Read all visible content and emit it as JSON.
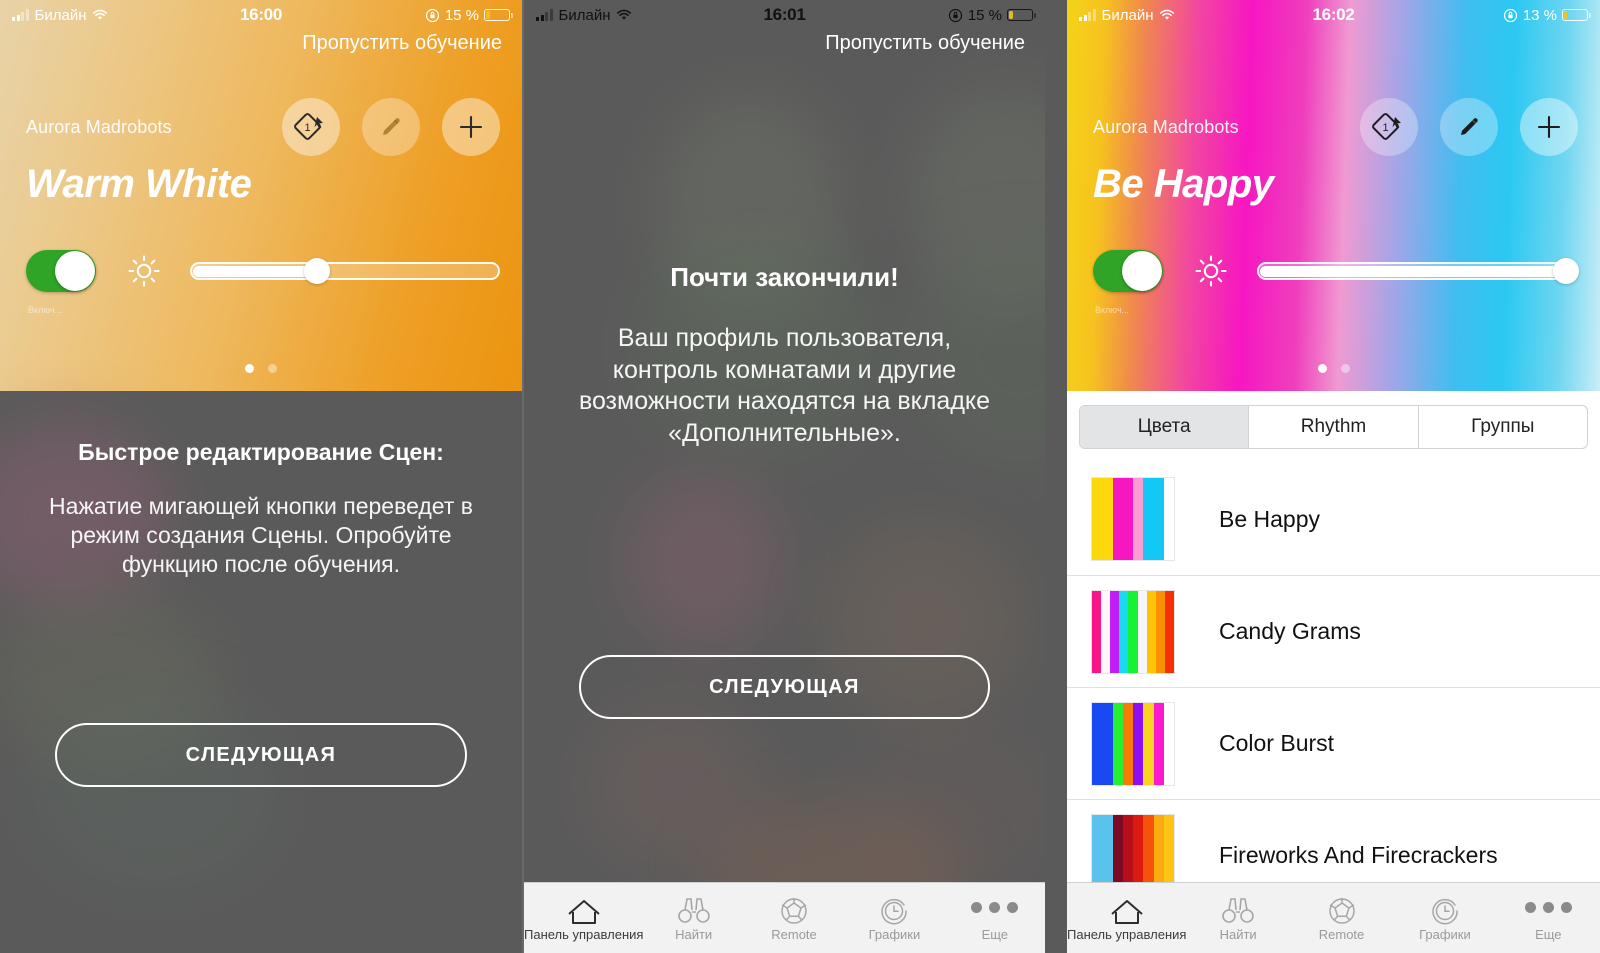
{
  "app": {
    "brand": "Aurora Madrobots",
    "skip_label": "Пропустить обучение"
  },
  "panels": [
    {
      "id": "panel-1",
      "status": {
        "carrier": "Билайн",
        "time": "16:00",
        "battery_pct": "15 %",
        "battery_level": 15,
        "style": "light"
      },
      "header": {
        "scene_name": "Warm White",
        "toggle_state": "on",
        "toggle_label": "Включ...",
        "brightness": 41,
        "page_dots": 2,
        "page_active": 0,
        "icons": [
          "scene-tag-icon",
          "pencil-icon",
          "plus-icon"
        ],
        "badge": "1",
        "gradient": [
          "#e8d3a8",
          "#eeb95f",
          "#eb9410"
        ]
      },
      "tutorial": {
        "title": "Быстрое редактирование Сцен:",
        "body": "Нажатие мигающей кнопки переведет в режим создания Сцены. Опробуйте функцию после обучения.",
        "next_label": "СЛЕДУЮЩАЯ"
      }
    },
    {
      "id": "panel-2",
      "status": {
        "carrier": "Билайн",
        "time": "16:01",
        "battery_pct": "15 %",
        "battery_level": 15,
        "style": "dark"
      },
      "tutorial": {
        "title": "Почти закончили!",
        "body": "Ваш профиль пользователя, контроль комнатами и другие возможности находятся на вкладке «Дополнительные».",
        "next_label": "СЛЕДУЮЩАЯ"
      },
      "tabbar": [
        {
          "label": "Панель управления",
          "icon": "home-icon",
          "active": true
        },
        {
          "label": "Найти",
          "icon": "binoculars-icon",
          "active": false
        },
        {
          "label": "Remote",
          "icon": "ball-icon",
          "active": false
        },
        {
          "label": "Графики",
          "icon": "clock-icon",
          "active": false
        },
        {
          "label": "Еще",
          "icon": "ellipsis-icon",
          "active": false
        }
      ]
    },
    {
      "id": "panel-3",
      "status": {
        "carrier": "Билайн",
        "time": "16:02",
        "battery_pct": "13 %",
        "battery_level": 13,
        "style": "light"
      },
      "header": {
        "scene_name": "Be Happy",
        "toggle_state": "on",
        "toggle_label": "Включ...",
        "brightness": 100,
        "page_dots": 2,
        "page_active": 0,
        "icons": [
          "scene-tag-icon",
          "pencil-icon",
          "plus-icon"
        ],
        "badge": "1",
        "gradient": [
          "#f5d319",
          "#f616c2",
          "#2bc8f2",
          "#c9edf7"
        ]
      },
      "segments": [
        {
          "label": "Цвета",
          "active": true
        },
        {
          "label": "Rhythm",
          "active": false
        },
        {
          "label": "Группы",
          "active": false
        }
      ],
      "scenes": [
        {
          "name": "Be Happy",
          "colors": [
            "#fdd80c",
            "#fdd80c",
            "#f717c0",
            "#f717c0",
            "#fb9dd5",
            "#14c8f5",
            "#14c8f5",
            "#ffffff"
          ]
        },
        {
          "name": "Candy Grams",
          "colors": [
            "#f7158a",
            "#fdf7f8",
            "#c01ef2",
            "#17dbf0",
            "#17f235",
            "#f5f7f9",
            "#fec404",
            "#fa8f02",
            "#f43007"
          ]
        },
        {
          "name": "Color Burst",
          "colors": [
            "#1a49f3",
            "#1a49f3",
            "#26ef31",
            "#f97a09",
            "#8d0ff0",
            "#fcd322",
            "#f919ce",
            "#ffffff"
          ]
        },
        {
          "name": "Fireworks And Firecrackers",
          "colors": [
            "#5bc2ed",
            "#5bc2ed",
            "#7b0b23",
            "#b70e1c",
            "#db1b12",
            "#f5520a",
            "#fbab10",
            "#fcc414"
          ]
        }
      ],
      "tabbar": [
        {
          "label": "Панель управления",
          "icon": "home-icon",
          "active": true
        },
        {
          "label": "Найти",
          "icon": "binoculars-icon",
          "active": false
        },
        {
          "label": "Remote",
          "icon": "ball-icon",
          "active": false
        },
        {
          "label": "Графики",
          "icon": "clock-icon",
          "active": false
        },
        {
          "label": "Еще",
          "icon": "ellipsis-icon",
          "active": false
        }
      ]
    }
  ]
}
